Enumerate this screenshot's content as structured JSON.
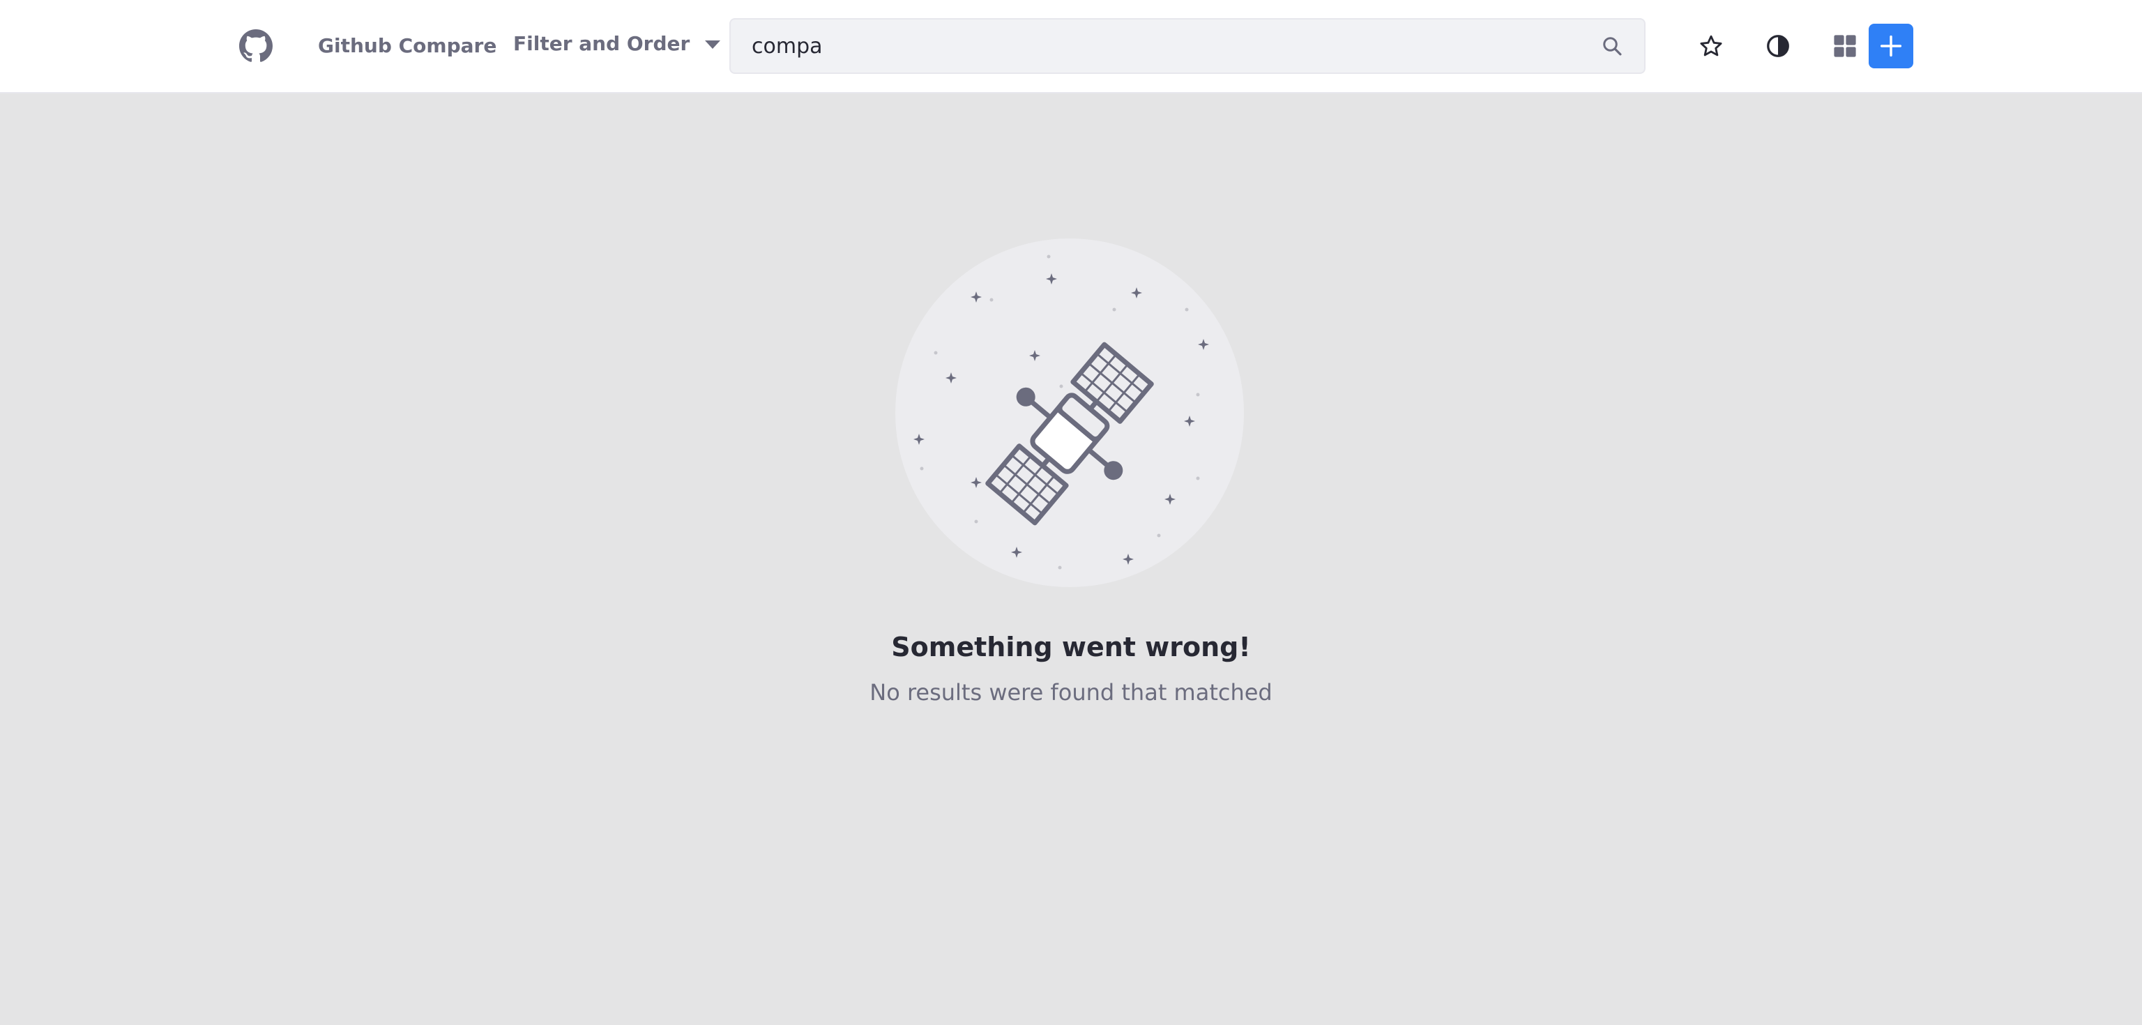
{
  "navbar": {
    "logo_icon": "github-logo-icon",
    "brand_label": "Github Compare",
    "filter_label": "Filter and Order",
    "search": {
      "value": "compa",
      "icon": "search-icon"
    },
    "actions": [
      {
        "name": "favorites",
        "icon": "star-icon"
      },
      {
        "name": "theme-toggle",
        "icon": "contrast-icon"
      },
      {
        "name": "display-mode",
        "icon": "grid-icon"
      },
      {
        "name": "add",
        "icon": "plus-icon"
      }
    ],
    "accent_color": "#2f80f6"
  },
  "empty_state": {
    "illustration_icon": "satellite-icon",
    "title": "Something went wrong!",
    "message": "No results were found that matched"
  }
}
